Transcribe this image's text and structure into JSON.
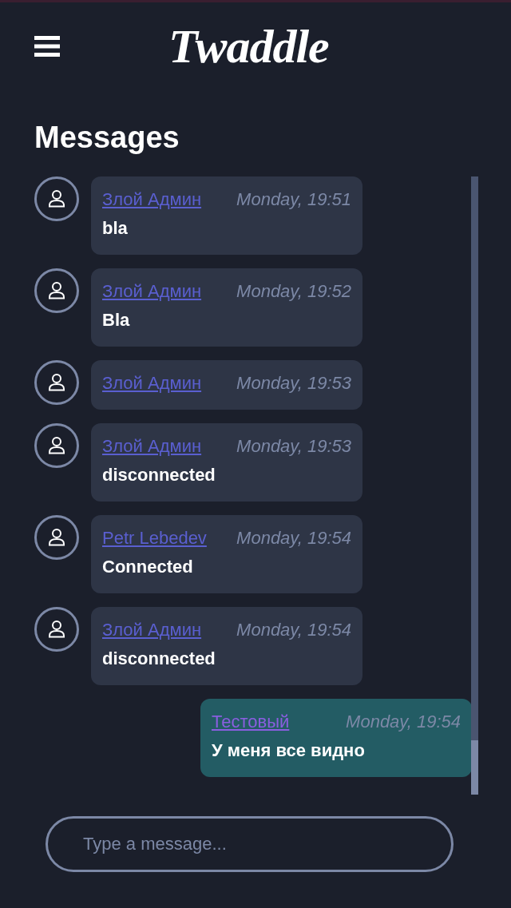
{
  "header": {
    "logo": "Twaddle"
  },
  "title": "Messages",
  "messages": [
    {
      "kind": "incoming",
      "author": "Злой Админ",
      "time": "Monday, 19:51",
      "text": "bla"
    },
    {
      "kind": "incoming",
      "author": "Злой Админ",
      "time": "Monday, 19:52",
      "text": "Bla"
    },
    {
      "kind": "incoming",
      "author": "Злой Админ",
      "time": "Monday, 19:53"
    },
    {
      "kind": "incoming",
      "author": "Злой Админ",
      "time": "Monday, 19:53",
      "text": "disconnected"
    },
    {
      "kind": "incoming",
      "author": "Petr Lebedev",
      "time": "Monday, 19:54",
      "text": "Connected"
    },
    {
      "kind": "incoming",
      "author": "Злой Админ",
      "time": "Monday, 19:54",
      "text": "disconnected"
    },
    {
      "kind": "own",
      "author": "Тестовый",
      "time": "Monday, 19:54",
      "text": "У меня все видно"
    }
  ],
  "composer": {
    "placeholder": "Type a message..."
  }
}
